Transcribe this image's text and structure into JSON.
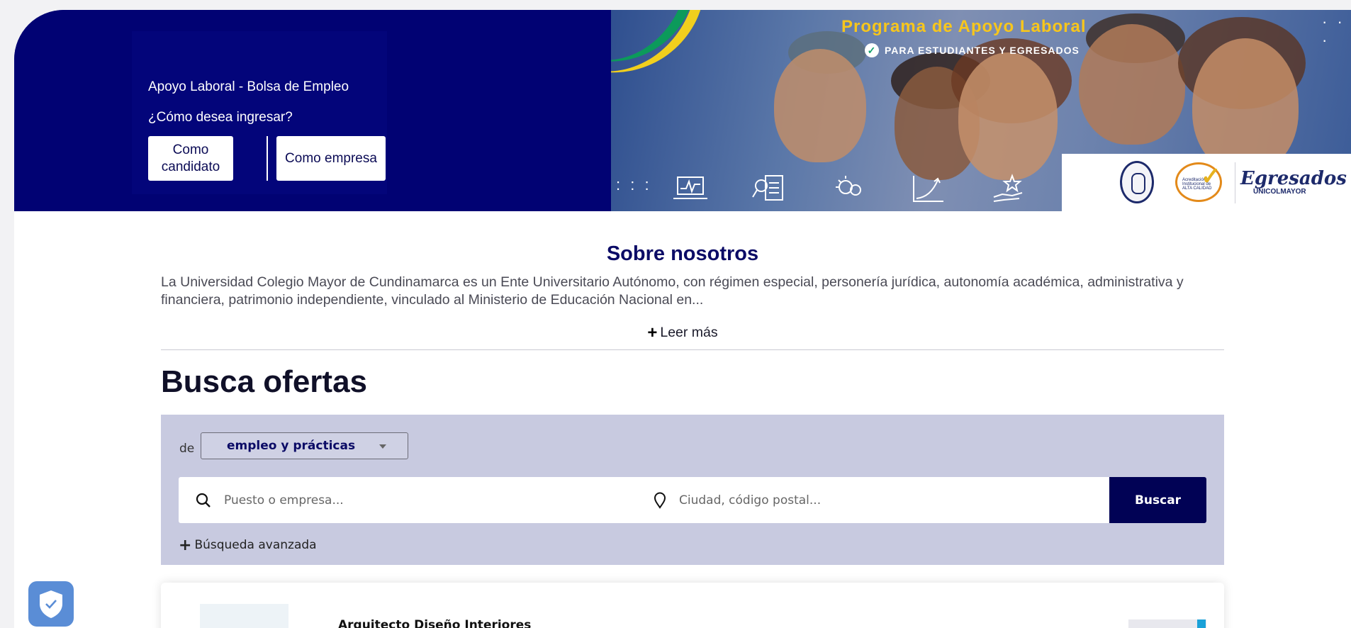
{
  "hero": {
    "title": "Apoyo Laboral - Bolsa de Empleo",
    "question": "¿Cómo desea ingresar?",
    "candidate_button": "Como candidato",
    "company_button": "Como empresa",
    "program_title": "Programa de Apoyo Laboral",
    "program_subtitle": "PARA ESTUDIANTES Y EGRESADOS",
    "logo_egresados": "Egresados",
    "logo_egresados_sub": "UNICOLMAYOR",
    "logo_accreditation": "Acreditación Institucional de ALTA CALIDAD"
  },
  "about": {
    "title": "Sobre nosotros",
    "text": "La Universidad Colegio Mayor de Cundinamarca es un Ente Universitario Autónomo, con régimen especial, personería jurídica, autonomía académica, administrativa y financiera, patrimonio independiente, vinculado al Ministerio de Educación Nacional en...",
    "read_more": "Leer más"
  },
  "search": {
    "title": "Busca ofertas",
    "de_label": "de",
    "type_selected": "empleo y prácticas",
    "query_placeholder": "Puesto o empresa...",
    "location_placeholder": "Ciudad, código postal...",
    "button": "Buscar",
    "advanced": "Búsqueda avanzada"
  },
  "jobs": [
    {
      "title": "Arquitecto Diseño Interiores"
    }
  ],
  "colors": {
    "navy": "#010273",
    "button_navy": "#010255",
    "panel": "#c8cae0",
    "accent_yellow": "#f7c61c"
  }
}
